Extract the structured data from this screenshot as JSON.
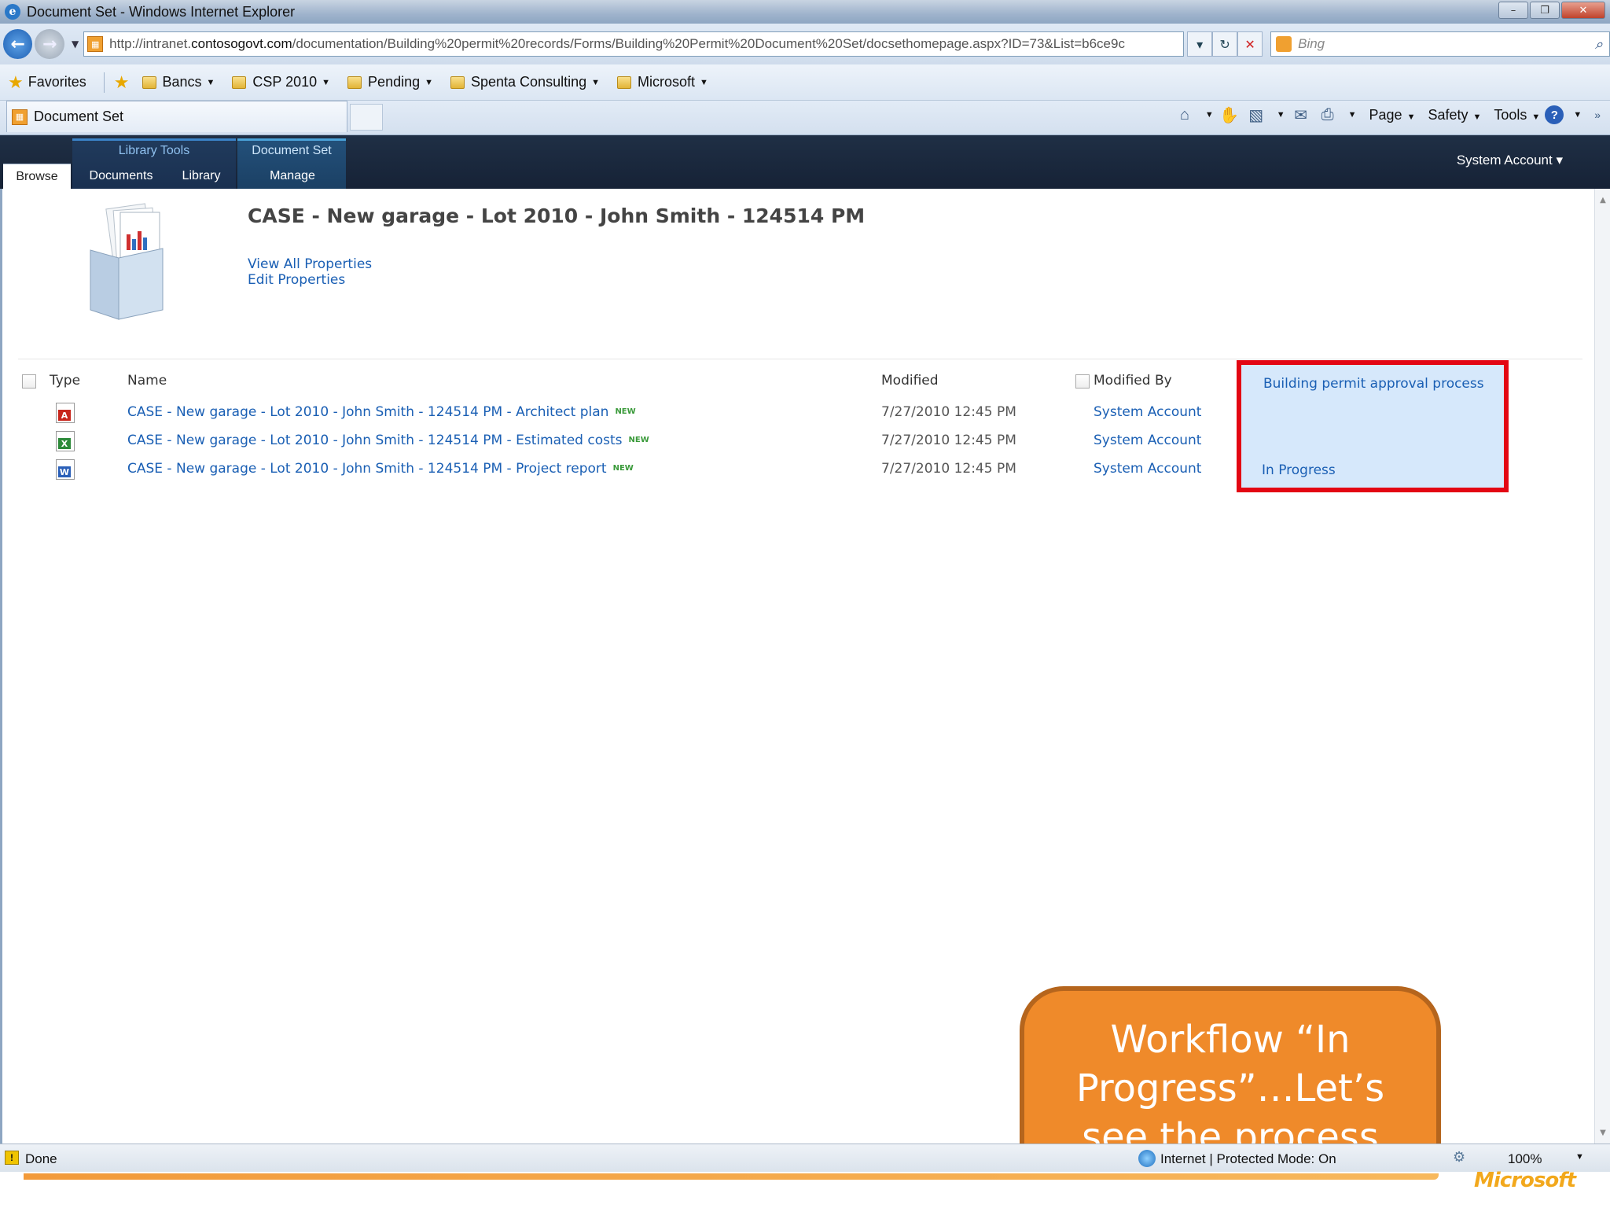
{
  "window": {
    "title": "Document Set - Windows Internet Explorer",
    "controls": [
      "–",
      "❐",
      "✕"
    ]
  },
  "address_bar": {
    "url_prefix": "http://intranet.",
    "url_domain": "contosogovt.com",
    "url_rest": "/documentation/Building%20permit%20records/Forms/Building%20Permit%20Document%20Set/docsethomepage.aspx?ID=73&List=b6ce9c",
    "search_placeholder": "Bing"
  },
  "favorites_bar": {
    "favorites_label": "Favorites",
    "items": [
      {
        "label": "Bancs"
      },
      {
        "label": "CSP 2010"
      },
      {
        "label": "Pending"
      },
      {
        "label": "Spenta Consulting"
      },
      {
        "label": "Microsoft"
      }
    ]
  },
  "tab": {
    "label": "Document Set"
  },
  "command_bar": {
    "page": "Page",
    "safety": "Safety",
    "tools": "Tools"
  },
  "ribbon": {
    "library_tools": "Library Tools",
    "document_set": "Document Set",
    "tabs": {
      "browse": "Browse",
      "documents": "Documents",
      "library": "Library",
      "manage": "Manage"
    },
    "user": "System Account ▾"
  },
  "page": {
    "title": "CASE - New garage - Lot 2010 - John Smith - 124514 PM",
    "view_all": "View All Properties",
    "edit": "Edit Properties"
  },
  "table": {
    "headers": {
      "type": "Type",
      "name": "Name",
      "modified": "Modified",
      "modified_by": "Modified By",
      "workflow": "Building permit approval process"
    },
    "new_badge": "NEW",
    "rows": [
      {
        "icon": "pdf",
        "name": "CASE - New garage - Lot 2010 - John Smith - 124514 PM - Architect plan",
        "modified": "7/27/2010 12:45 PM",
        "modified_by": "System Account"
      },
      {
        "icon": "xls",
        "name": "CASE - New garage - Lot 2010 - John Smith - 124514 PM - Estimated costs",
        "modified": "7/27/2010 12:45 PM",
        "modified_by": "System Account"
      },
      {
        "icon": "doc",
        "name": "CASE - New garage - Lot 2010 - John Smith - 124514 PM - Project report",
        "modified": "7/27/2010 12:45 PM",
        "modified_by": "System Account"
      }
    ],
    "workflow_status": "In Progress"
  },
  "callout": {
    "text": "Workflow “In Progress”…Let’s see the process detail…"
  },
  "status_bar": {
    "left": "Done",
    "zone": "Internet | Protected Mode: On",
    "zoom": "100%"
  },
  "footer": {
    "brand": "Microsoft"
  },
  "colors": {
    "ribbon_bg": "#1c2a40",
    "link": "#1a5fb4",
    "highlight_border": "#e30613",
    "workflow_bg": "#d6e8fb",
    "callout_fill": "#ef8a2a"
  }
}
